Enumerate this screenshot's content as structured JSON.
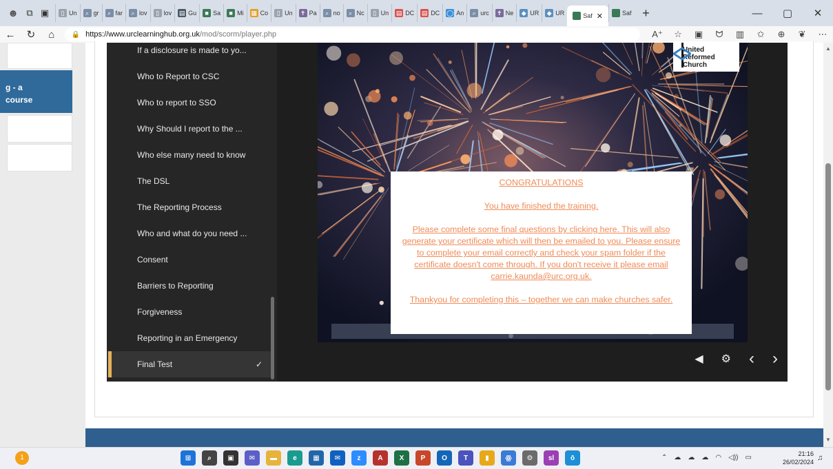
{
  "browser": {
    "tabs": [
      {
        "label": "Un",
        "icon": "page-icon",
        "color": "#9aa3ad"
      },
      {
        "label": "gr",
        "icon": "search-icon",
        "color": "#7a8ea8"
      },
      {
        "label": "far",
        "icon": "search-icon",
        "color": "#7a8ea8"
      },
      {
        "label": "lov",
        "icon": "search-icon",
        "color": "#7a8ea8"
      },
      {
        "label": "lov",
        "icon": "page-icon",
        "color": "#9aa3ad"
      },
      {
        "label": "Gu",
        "icon": "doc-icon",
        "color": "#4a5a6a"
      },
      {
        "label": "Sa",
        "icon": "teams-icon",
        "color": "#3b7a57"
      },
      {
        "label": "Mi",
        "icon": "teams-icon",
        "color": "#3b7a57"
      },
      {
        "label": "Co",
        "icon": "grid-icon",
        "color": "#e0a02a"
      },
      {
        "label": "Un",
        "icon": "page-icon",
        "color": "#9aa3ad"
      },
      {
        "label": "Pa",
        "icon": "cross-icon",
        "color": "#7a6a9a"
      },
      {
        "label": "no",
        "icon": "search-icon",
        "color": "#7a8ea8"
      },
      {
        "label": "Nc",
        "icon": "search-icon",
        "color": "#7a8ea8"
      },
      {
        "label": "Un",
        "icon": "page-icon",
        "color": "#9aa3ad"
      },
      {
        "label": "DC",
        "icon": "pdf-icon",
        "color": "#d9534f"
      },
      {
        "label": "DC",
        "icon": "pdf-icon",
        "color": "#d9534f"
      },
      {
        "label": "An",
        "icon": "circle-icon",
        "color": "#3a8fd9"
      },
      {
        "label": "urc",
        "icon": "search-icon",
        "color": "#7a8ea8"
      },
      {
        "label": "Ne",
        "icon": "cross-icon",
        "color": "#7a6a9a"
      },
      {
        "label": "UR",
        "icon": "diamond-icon",
        "color": "#5b8fbf"
      },
      {
        "label": "UR",
        "icon": "diamond-icon",
        "color": "#5b8fbf"
      }
    ],
    "active_tab": {
      "label": "Saf",
      "color": "#3b7a57"
    },
    "extra_tab": {
      "label": "Saf",
      "color": "#3b7a57"
    },
    "new_tab_glyph": "+",
    "window_controls": [
      "—",
      "▢",
      "✕"
    ],
    "url_host": "https://www.urclearninghub.org.uk",
    "url_path": "/mod/scorm/player.php",
    "nav_icons": [
      "A⁺",
      "☆",
      "▣",
      "ᗢ",
      "▥",
      "✩",
      "⊕",
      "❦",
      "⋯"
    ]
  },
  "sidebar": {
    "active_label_line1": "g - a",
    "active_label_line2": "course"
  },
  "toc": {
    "items": [
      {
        "label": "If a disclosure is made to yo..."
      },
      {
        "label": "Who to Report to CSC"
      },
      {
        "label": "Who to report to SSO"
      },
      {
        "label": "Why Should I report to the ..."
      },
      {
        "label": "Who else many need to know"
      },
      {
        "label": "The DSL"
      },
      {
        "label": "The Reporting Process"
      },
      {
        "label": "Who and what do you need ..."
      },
      {
        "label": "Consent"
      },
      {
        "label": "Barriers to Reporting"
      },
      {
        "label": "Forgiveness"
      },
      {
        "label": "Reporting in an Emergency"
      },
      {
        "label": "Final Test",
        "completed": true
      }
    ],
    "check_glyph": "✓"
  },
  "logo": {
    "line1": "United",
    "line2": "Reformed",
    "line3": "Church"
  },
  "message": {
    "heading": "CONGRATULATIONS",
    "finished": "You have finished the training.",
    "instructions": "Please complete some final questions by clicking here. This will also generate your certificate which will then be emailed to you. Please ensure to complete your email correctly and check your spam folder if the certificate doesn't come through. If you don't receive it please email carrie.kaunda@urc.org.uk.",
    "thanks": "Thankyou for completing this – together we can make churches safer.",
    "text_color": "#f08a56"
  },
  "player_controls": {
    "volume": "◀",
    "settings": "⚙",
    "prev": "‹",
    "next": "›"
  },
  "taskbar": {
    "apps": [
      {
        "name": "windows-start-icon",
        "glyph": "⊞",
        "color": "#1e73d8"
      },
      {
        "name": "search-icon",
        "glyph": "⌕",
        "color": "#444444"
      },
      {
        "name": "taskview-icon",
        "glyph": "▣",
        "color": "#333333"
      },
      {
        "name": "chat-icon",
        "glyph": "✉",
        "color": "#5b5fc7"
      },
      {
        "name": "explorer-icon",
        "glyph": "▬",
        "color": "#e6b43c"
      },
      {
        "name": "edge-icon",
        "glyph": "e",
        "color": "#1a9b8f"
      },
      {
        "name": "calculator-icon",
        "glyph": "▦",
        "color": "#2266aa"
      },
      {
        "name": "mail-icon",
        "glyph": "✉",
        "color": "#1060c0"
      },
      {
        "name": "zoom-icon",
        "glyph": "z",
        "color": "#2d8cff"
      },
      {
        "name": "access-icon",
        "glyph": "A",
        "color": "#b7322c"
      },
      {
        "name": "excel-icon",
        "glyph": "X",
        "color": "#1d7044"
      },
      {
        "name": "powerpoint-icon",
        "glyph": "P",
        "color": "#c8472b"
      },
      {
        "name": "outlook-icon",
        "glyph": "O",
        "color": "#1466b8"
      },
      {
        "name": "teams-icon",
        "glyph": "T",
        "color": "#4b53bc"
      },
      {
        "name": "sticky-icon",
        "glyph": "▮",
        "color": "#e7a81a"
      },
      {
        "name": "people-icon",
        "glyph": "ꙮ",
        "color": "#3a7bd5"
      },
      {
        "name": "settings-icon",
        "glyph": "⚙",
        "color": "#6b6b6b"
      },
      {
        "name": "app-sl-icon",
        "glyph": "sl",
        "color": "#9b3fb5"
      },
      {
        "name": "app-o-icon",
        "glyph": "ō",
        "color": "#1c8fd6"
      }
    ],
    "tray": [
      "⌃",
      "☁",
      "☁",
      "☁",
      "◠",
      "◁))",
      "▭"
    ],
    "time": "21:16",
    "date": "26/02/2024",
    "notif_glyph": "🔔"
  }
}
